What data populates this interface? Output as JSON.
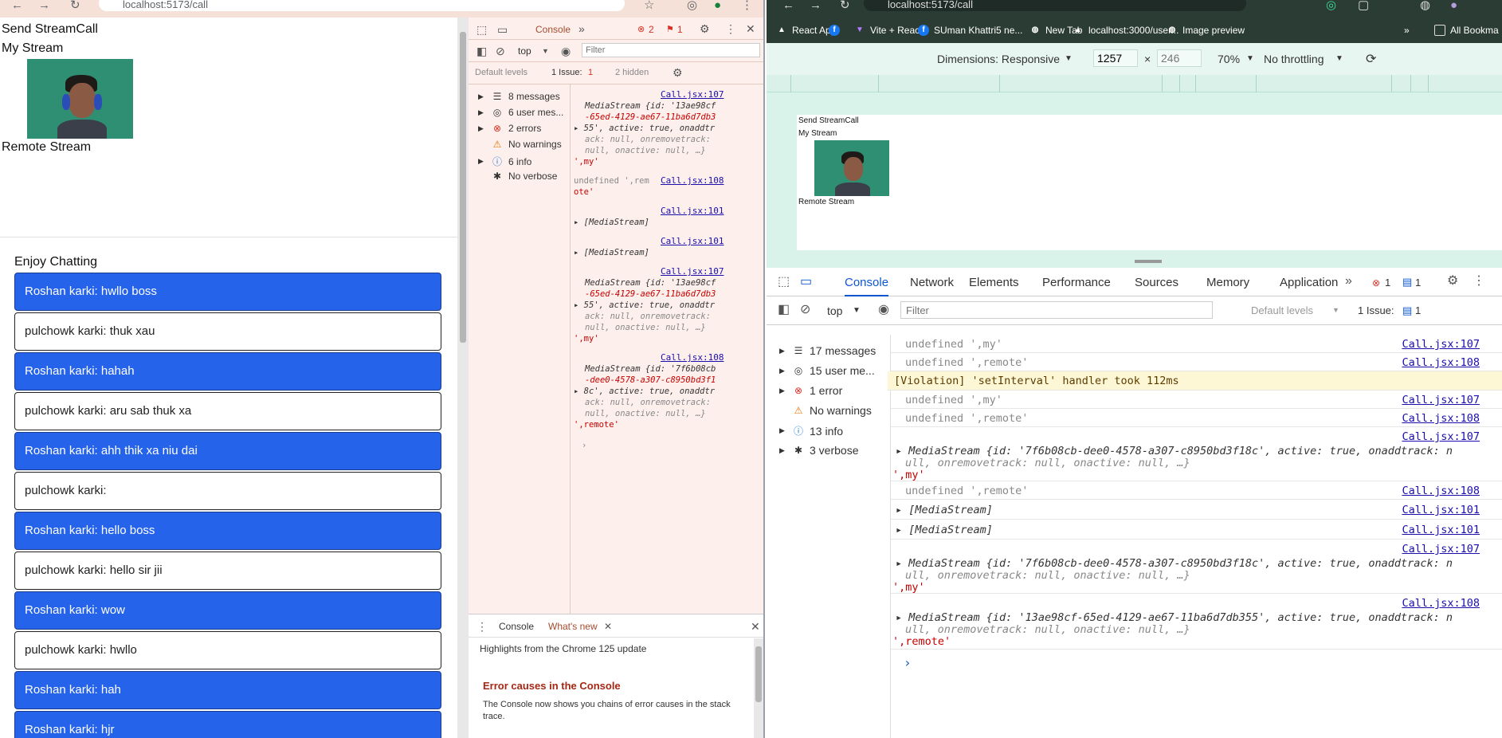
{
  "left_window": {
    "url": "localhost:5173/call",
    "page": {
      "send_label": "Send StreamCall",
      "my_stream_label": "My Stream",
      "remote_stream_label": "Remote Stream",
      "chat_title": "Enjoy Chatting",
      "messages": [
        {
          "text": "Roshan karki: hwllo boss",
          "style": "blue"
        },
        {
          "text": "pulchowk karki: thuk xau",
          "style": "white"
        },
        {
          "text": "Roshan karki: hahah",
          "style": "blue"
        },
        {
          "text": "pulchowk karki: aru sab thuk xa",
          "style": "white"
        },
        {
          "text": "Roshan karki: ahh thik xa niu dai",
          "style": "blue"
        },
        {
          "text": "pulchowk karki:",
          "style": "white"
        },
        {
          "text": "Roshan karki: hello boss",
          "style": "blue"
        },
        {
          "text": "pulchowk karki: hello sir jii",
          "style": "white"
        },
        {
          "text": "Roshan karki: wow",
          "style": "blue"
        },
        {
          "text": "pulchowk karki: hwllo",
          "style": "white"
        },
        {
          "text": "Roshan karki: hah",
          "style": "blue"
        },
        {
          "text": "Roshan karki: hjr",
          "style": "blue"
        }
      ]
    },
    "devtools": {
      "tab_console": "Console",
      "error_count": "2",
      "issue_count": "1",
      "context": "top",
      "filter_placeholder": "Filter",
      "default_levels": "Default levels",
      "issues_label": "1 Issue:",
      "issues_num": "1",
      "hidden": "2 hidden",
      "sidebar": [
        {
          "label": "8 messages",
          "icon": "list-icon"
        },
        {
          "label": "6 user mes...",
          "icon": "user-icon"
        },
        {
          "label": "2 errors",
          "icon": "error-icon"
        },
        {
          "label": "No warnings",
          "icon": "warning-icon"
        },
        {
          "label": "6 info",
          "icon": "info-icon"
        },
        {
          "label": "No verbose",
          "icon": "bug-icon"
        }
      ],
      "logs": {
        "l1_link": "Call.jsx:107",
        "l1_a": "MediaStream {id: '13ae98cf",
        "l1_b": "-65ed-4129-ae67-11ba6d7db3",
        "l1_c": "55', active: true, onaddtr",
        "l1_d": "ack: null, onremovetrack:",
        "l1_e": "null, onactive: null, …}",
        "l1_f": "',my'",
        "l2_a": "undefined ',rem",
        "l2_link": "Call.jsx:108",
        "l2_b": "ote'",
        "l3_link": "Call.jsx:101",
        "l3_a": "[MediaStream]",
        "l4_link": "Call.jsx:101",
        "l4_a": "[MediaStream]",
        "l5_link": "Call.jsx:107",
        "l5_a": "MediaStream {id: '13ae98cf",
        "l5_b": "-65ed-4129-ae67-11ba6d7db3",
        "l5_c": "55', active: true, onaddtr",
        "l5_d": "ack: null, onremovetrack:",
        "l5_e": "null, onactive: null, …}",
        "l5_f": "',my'",
        "l6_link": "Call.jsx:108",
        "l6_a": "MediaStream {id: '7f6b08cb",
        "l6_b": "-dee0-4578-a307-c8950bd3f1",
        "l6_c": "8c', active: true, onaddtr",
        "l6_d": "ack: null, onremovetrack:",
        "l6_e": "null, onactive: null, …}",
        "l6_f": "',remote'"
      },
      "drawer_console": "Console",
      "drawer_whatsnew": "What's new",
      "drawer_highlight": "Highlights from the Chrome 125 update",
      "drawer_heading": "Error causes in the Console",
      "drawer_body": "The Console now shows you chains of error causes in the stack trace."
    }
  },
  "right_window": {
    "url": "localhost:5173/call",
    "bookmarks": [
      {
        "label": "React App",
        "icon": "triangle-icon"
      },
      {
        "label": "",
        "icon": "facebook-icon"
      },
      {
        "label": "Vite + React",
        "icon": "vite-icon"
      },
      {
        "label": "SUman Khattri5 ne...",
        "icon": "facebook-icon"
      },
      {
        "label": "New Tab",
        "icon": "globe-icon"
      },
      {
        "label": "localhost:3000/user...",
        "icon": "triangle-icon"
      },
      {
        "label": "Image preview",
        "icon": "globe-icon"
      }
    ],
    "all_bookmarks": "All Bookma",
    "device_toolbar": {
      "dimensions": "Dimensions: Responsive",
      "width": "1257",
      "height": "246",
      "zoom": "70%",
      "throttle": "No throttling"
    },
    "preview": {
      "send_label": "Send StreamCall",
      "my_stream_label": "My Stream",
      "remote_stream_label": "Remote Stream"
    },
    "devtools": {
      "tabs": [
        "Console",
        "Network",
        "Elements",
        "Performance",
        "Sources",
        "Memory",
        "Application"
      ],
      "error_count": "1",
      "msg_count": "1",
      "context": "top",
      "filter_placeholder": "Filter",
      "default_levels": "Default levels",
      "issues_label": "1 Issue:",
      "issues_num": "1",
      "sidebar": [
        {
          "label": "17 messages",
          "icon": "list-icon"
        },
        {
          "label": "15 user me...",
          "icon": "user-icon"
        },
        {
          "label": "1 error",
          "icon": "error-icon"
        },
        {
          "label": "No warnings",
          "icon": "warning-icon"
        },
        {
          "label": "13 info",
          "icon": "info-icon"
        },
        {
          "label": "3 verbose",
          "icon": "bug-icon"
        }
      ],
      "logs": {
        "r1": "undefined ',my'",
        "r1_link": "Call.jsx:107",
        "r2": "undefined ',remote'",
        "r2_link": "Call.jsx:108",
        "r3": "[Violation] 'setInterval' handler took 112ms",
        "r4": "undefined ',my'",
        "r4_link": "Call.jsx:107",
        "r5": "undefined ',remote'",
        "r5_link": "Call.jsx:108",
        "r6_link": "Call.jsx:107",
        "r6_a": "MediaStream {id: '7f6b08cb-dee0-4578-a307-c8950bd3f18c', active: true, onaddtrack: n",
        "r6_b": "ull, onremovetrack: null, onactive: null, …}",
        "r6_c": "',my'",
        "r7": "undefined ',remote'",
        "r7_link": "Call.jsx:108",
        "r8": "[MediaStream]",
        "r8_link": "Call.jsx:101",
        "r9": "[MediaStream]",
        "r9_link": "Call.jsx:101",
        "r10_link": "Call.jsx:107",
        "r10_a": "MediaStream {id: '7f6b08cb-dee0-4578-a307-c8950bd3f18c', active: true, onaddtrack: n",
        "r10_b": "ull, onremovetrack: null, onactive: null, …}",
        "r10_c": "',my'",
        "r11_link": "Call.jsx:108",
        "r11_a": "MediaStream {id: '13ae98cf-65ed-4129-ae67-11ba6d7db355', active: true, onaddtrack: n",
        "r11_b": "ull, onremovetrack: null, onactive: null, …}",
        "r11_c": "',remote'"
      }
    }
  }
}
